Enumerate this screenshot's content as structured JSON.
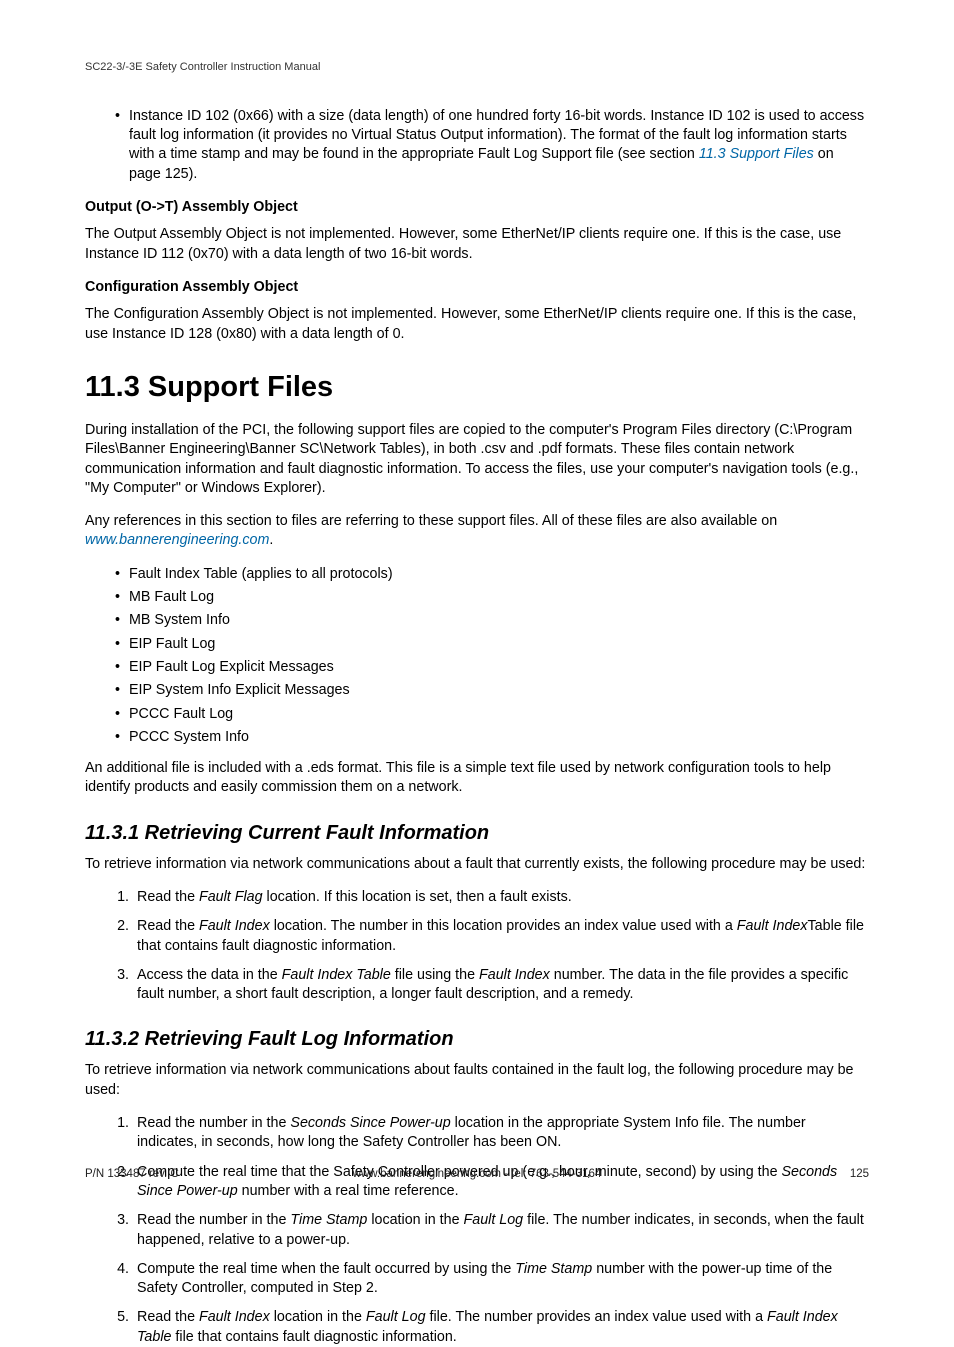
{
  "header": "SC22-3/-3E Safety Controller Instruction Manual",
  "topBullet": {
    "pre": "Instance ID 102 (0x66) with a size (data length) of one hundred forty 16-bit words. Instance ID 102 is used to access fault log information (it provides no Virtual Status Output information). The format of the fault log information starts with a time stamp and may be found in the appropriate Fault Log Support file (see section ",
    "link": "11.3 Support Files",
    "post": " on page 125)."
  },
  "outputHead": "Output (O->T) Assembly Object",
  "outputPara": "The Output Assembly Object is not implemented. However, some EtherNet/IP clients require one. If this is the case, use Instance ID 112 (0x70) with a data length of two 16-bit words.",
  "configHead": "Configuration Assembly Object",
  "configPara": "The Configuration Assembly Object is not implemented. However, some EtherNet/IP clients require one. If this is the case, use Instance ID 128 (0x80) with a data length of 0.",
  "secTitle": "11.3 Support Files",
  "secPara1": "During installation of the PCI, the following support files are copied to the computer's Program Files directory (C:\\Program Files\\Banner Engineering\\Banner SC\\Network Tables), in both .csv and .pdf formats. These files contain network communication information and fault diagnostic information. To access the files, use your computer's navigation tools (e.g., \"My Computer\" or Windows Explorer).",
  "secPara2": {
    "pre": "Any references in this section to files are referring to these support files. All of these files are also available on ",
    "link": "www.bannerengineering.com",
    "post": "."
  },
  "files": [
    "Fault Index Table (applies to all protocols)",
    "MB Fault Log",
    "MB System Info",
    "EIP Fault Log",
    "EIP Fault Log Explicit Messages",
    "EIP System Info Explicit Messages",
    "PCCC Fault Log",
    "PCCC System Info"
  ],
  "edsPara": "An additional file is included with a .eds format. This file is a simple text file used by network configuration tools to help identify products and easily commission them on a network.",
  "sub1Title": "11.3.1 Retrieving Current Fault Information",
  "sub1Intro": "To retrieve information via network communications about a fault that currently exists, the following procedure may be used:",
  "sub1Steps": [
    [
      {
        "t": "Read the "
      },
      {
        "i": "Fault Flag"
      },
      {
        "t": " location. If this location is set, then a fault exists."
      }
    ],
    [
      {
        "t": "Read the "
      },
      {
        "i": "Fault Index"
      },
      {
        "t": " location. The number in this location provides an index value used with a "
      },
      {
        "i": "Fault Index"
      },
      {
        "t": "Table file that contains fault diagnostic information."
      }
    ],
    [
      {
        "t": "Access the data in the "
      },
      {
        "i": "Fault Index Table"
      },
      {
        "t": " file using the "
      },
      {
        "i": "Fault Index"
      },
      {
        "t": " number. The data in the file provides a specific fault number, a short fault description, a longer fault description, and a remedy."
      }
    ]
  ],
  "sub2Title": "11.3.2 Retrieving Fault Log Information",
  "sub2Intro": "To retrieve information via network communications about faults contained in the fault log, the following procedure may be used:",
  "sub2Steps": [
    [
      {
        "t": "Read the number in the "
      },
      {
        "i": "Seconds Since Power-up"
      },
      {
        "t": " location in the appropriate System Info file. The number indicates, in seconds, how long the Safety Controller has been ON."
      }
    ],
    [
      {
        "t": "Compute the real time that the Safety Controller powered up (e.g., hour, minute, second) by using the "
      },
      {
        "i": "Seconds Since Power-up"
      },
      {
        "t": " number with a real time reference."
      }
    ],
    [
      {
        "t": "Read the number in the "
      },
      {
        "i": "Time Stamp"
      },
      {
        "t": " location in the "
      },
      {
        "i": "Fault Log"
      },
      {
        "t": " file. The number indicates, in seconds, when the fault happened, relative to a power-up."
      }
    ],
    [
      {
        "t": "Compute the real time when the fault occurred by using the "
      },
      {
        "i": "Time Stamp"
      },
      {
        "t": " number with the power-up time of the Safety Controller, computed in Step 2."
      }
    ],
    [
      {
        "t": "Read the "
      },
      {
        "i": "Fault Index"
      },
      {
        "t": " location in the "
      },
      {
        "i": "Fault Log"
      },
      {
        "t": " file. The number provides an index value used with a "
      },
      {
        "i": "Fault Index Table"
      },
      {
        "t": " file that contains fault diagnostic information."
      }
    ]
  ],
  "footer": {
    "left": "P/N 133487 rev. C",
    "center": "www.bannerengineering.com - tel: 763-544-3164",
    "right": "125"
  }
}
